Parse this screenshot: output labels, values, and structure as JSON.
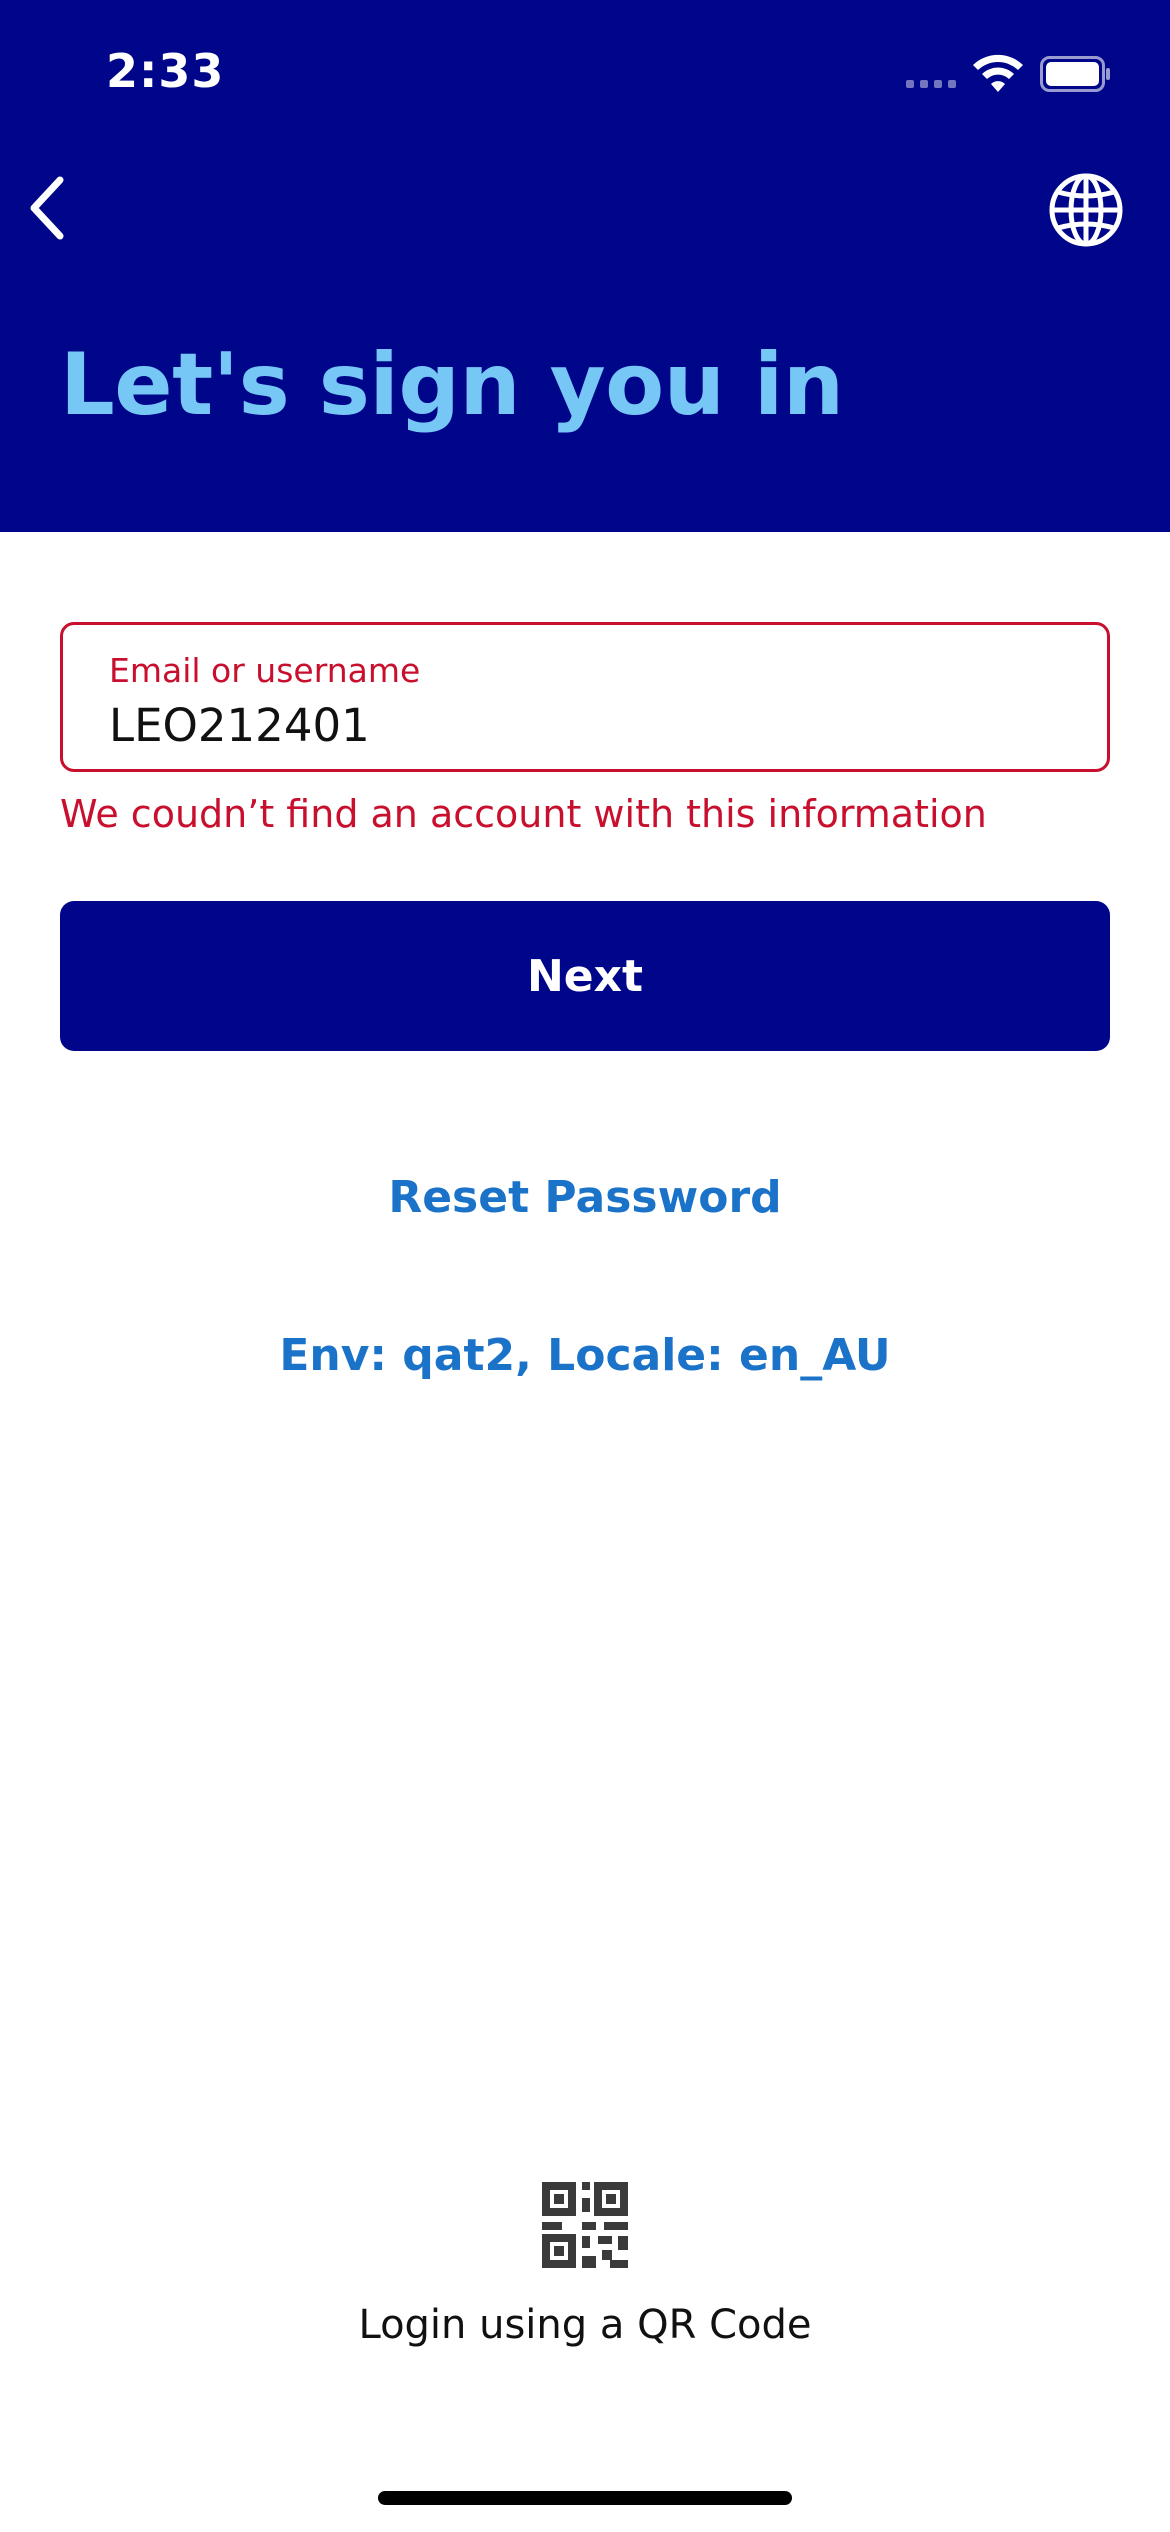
{
  "status_bar": {
    "time": "2:33"
  },
  "header": {
    "back_icon": "chevron-left-icon",
    "language_icon": "globe-icon",
    "title": "Let's sign you in",
    "background_color": "#000689",
    "title_color": "#76c7f5"
  },
  "form": {
    "email_label": "Email or username",
    "email_value": "LEO212401",
    "error_message": "We coudn’t find an account with this information",
    "error_color": "#c8102e",
    "next_label": "Next"
  },
  "links": {
    "reset_password": "Reset Password",
    "env_info": "Env: qat2, Locale: en_AU",
    "link_color": "#1a73c8"
  },
  "qr_login": {
    "icon": "qr-code-icon",
    "label": "Login using a QR Code"
  }
}
